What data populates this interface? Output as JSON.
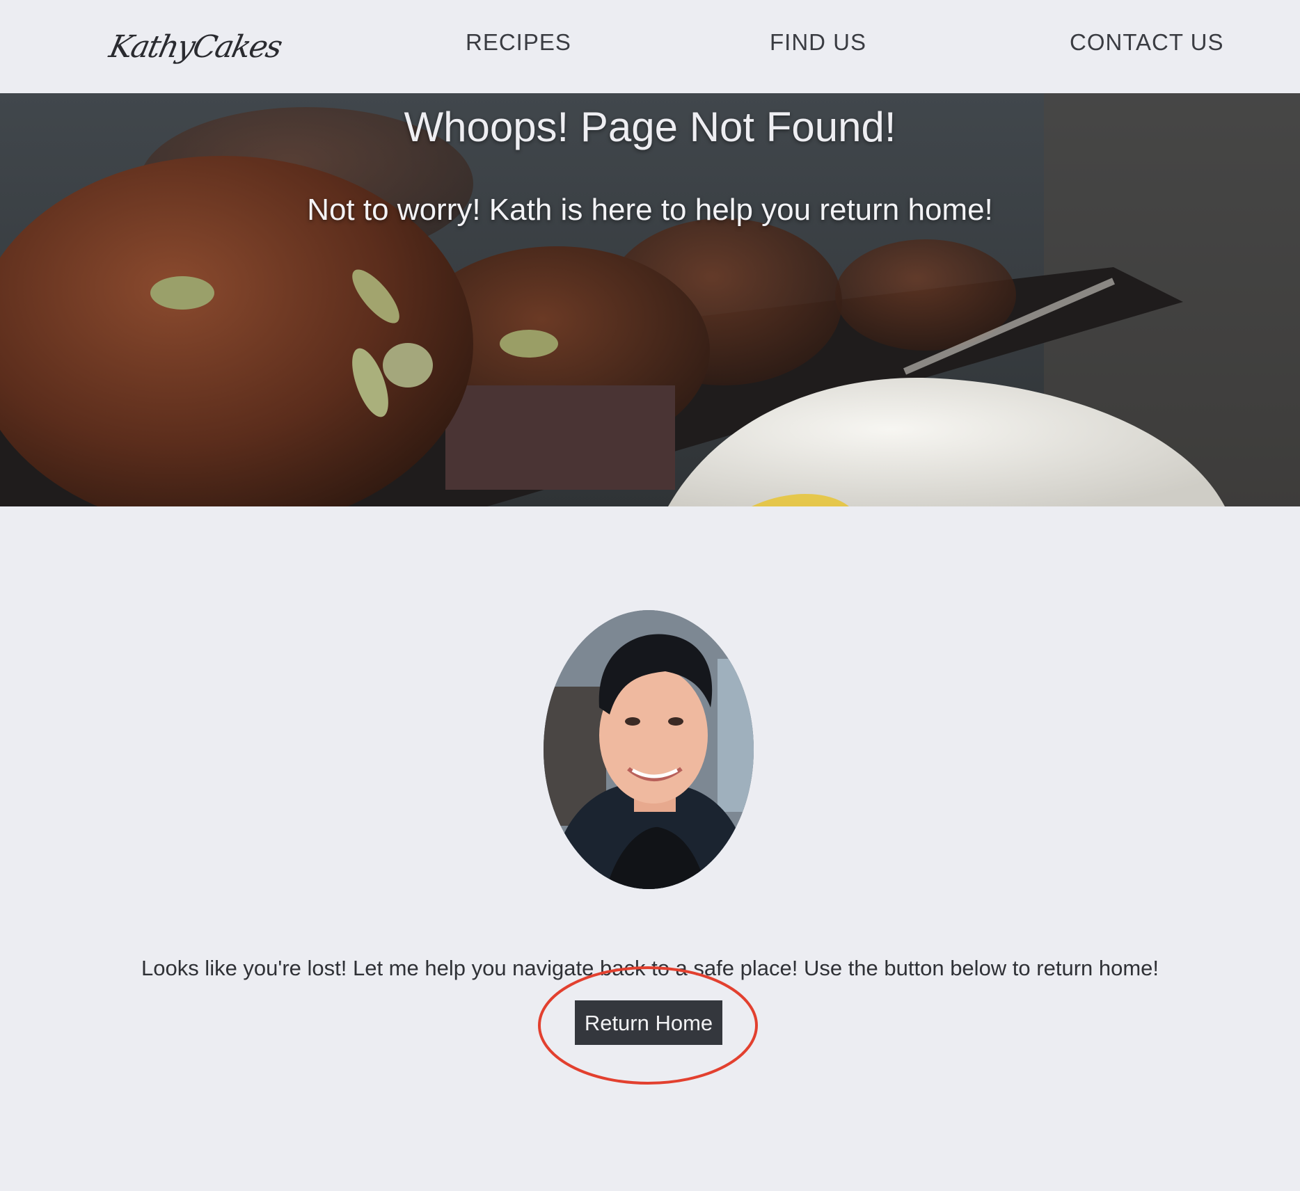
{
  "header": {
    "logo_text": "KathyCakes",
    "nav": {
      "recipes": "RECIPES",
      "find_us": "FIND US",
      "contact_us": "CONTACT US"
    }
  },
  "hero": {
    "title": "Whoops! Page Not Found!",
    "subtitle": "Not to worry! Kath is here to help you return home!"
  },
  "main": {
    "message": "Looks like you're lost! Let me help you navigate back to a safe place! Use the button below to return home!",
    "button_label": "Return Home"
  },
  "colors": {
    "background": "#ecedf2",
    "button": "#34373d",
    "annotation": "#e2402f"
  }
}
